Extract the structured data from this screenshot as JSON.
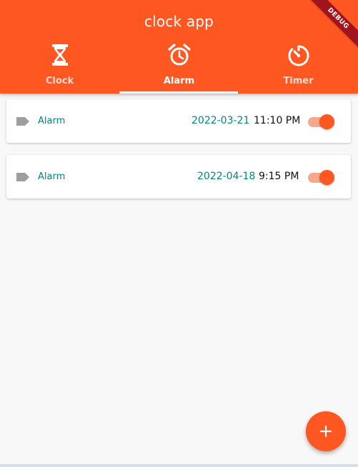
{
  "app": {
    "title": "clock app",
    "debug_banner": "DEBUG",
    "accent_color": "#ff5722",
    "teal_text_color": "#00897b"
  },
  "tabs": [
    {
      "label": "Clock",
      "icon": "hourglass-icon",
      "selected": false
    },
    {
      "label": "Alarm",
      "icon": "alarm-clock-icon",
      "selected": true
    },
    {
      "label": "Timer",
      "icon": "timer-icon",
      "selected": false
    }
  ],
  "alarms": [
    {
      "label": "Alarm",
      "date": "2022-03-21",
      "time": "11:10 PM",
      "enabled": true,
      "icon": "label-tag-icon"
    },
    {
      "label": "Alarm",
      "date": "2022-04-18",
      "time": "9:15 PM",
      "enabled": true,
      "icon": "label-tag-icon"
    }
  ],
  "fab": {
    "icon": "plus-icon"
  }
}
